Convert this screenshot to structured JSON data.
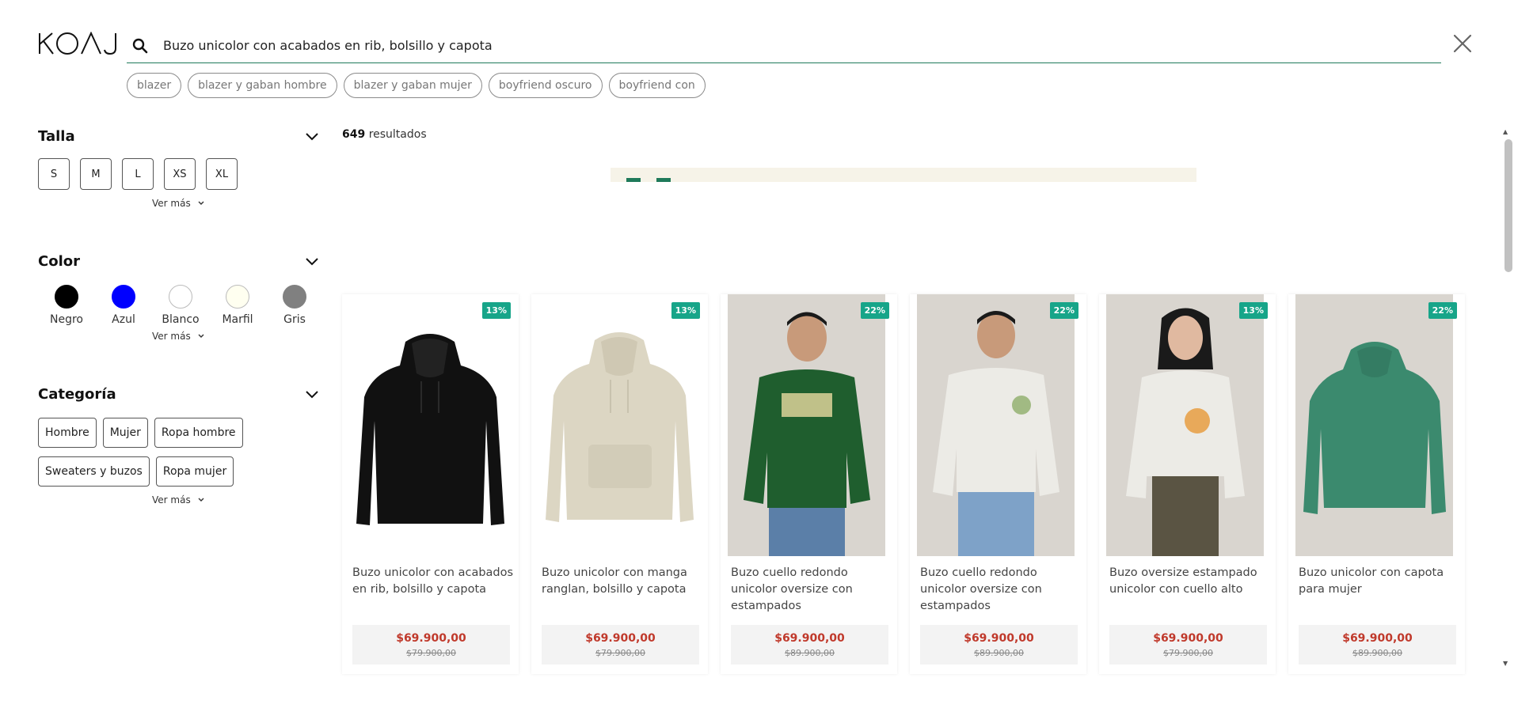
{
  "header": {
    "logo_text": "KOAJ",
    "search_value": "Buzo unicolor con acabados en rib, bolsillo y capota",
    "suggestions": [
      "blazer",
      "blazer y gaban hombre",
      "blazer y gaban mujer",
      "boyfriend oscuro",
      "boyfriend con"
    ]
  },
  "filters": {
    "talla": {
      "title": "Talla",
      "sizes": [
        "S",
        "M",
        "L",
        "XS",
        "XL"
      ],
      "more_label": "Ver más"
    },
    "color": {
      "title": "Color",
      "colors": [
        {
          "label": "Negro",
          "hex": "#000000"
        },
        {
          "label": "Azul",
          "hex": "#0000ff"
        },
        {
          "label": "Blanco",
          "hex": "#ffffff"
        },
        {
          "label": "Marfil",
          "hex": "#fffff0"
        },
        {
          "label": "Gris",
          "hex": "#808080"
        }
      ],
      "more_label": "Ver más"
    },
    "categoria": {
      "title": "Categoría",
      "items": [
        "Hombre",
        "Mujer",
        "Ropa hombre",
        "Sweaters y buzos",
        "Ropa mujer"
      ],
      "more_label": "Ver más"
    }
  },
  "results": {
    "count": "649",
    "label": "resultados"
  },
  "products": [
    {
      "name": "Buzo unicolor con acabados en rib, bolsillo y capota",
      "discount": "13%",
      "price": "$69.900,00",
      "old_price": "$79.900,00"
    },
    {
      "name": "Buzo unicolor con manga ranglan, bolsillo y capota",
      "discount": "13%",
      "price": "$69.900,00",
      "old_price": "$79.900,00"
    },
    {
      "name": "Buzo cuello redondo unicolor oversize con estampados",
      "discount": "22%",
      "price": "$69.900,00",
      "old_price": "$89.900,00"
    },
    {
      "name": "Buzo cuello redondo unicolor oversize con estampados",
      "discount": "22%",
      "price": "$69.900,00",
      "old_price": "$89.900,00"
    },
    {
      "name": "Buzo oversize estampado unicolor con cuello alto",
      "discount": "13%",
      "price": "$69.900,00",
      "old_price": "$79.900,00"
    },
    {
      "name": "Buzo unicolor con capota para mujer",
      "discount": "22%",
      "price": "$69.900,00",
      "old_price": "$89.900,00"
    }
  ],
  "colors": {
    "accent": "#1f7a5a",
    "badge": "#17a589",
    "price": "#c0392b"
  }
}
